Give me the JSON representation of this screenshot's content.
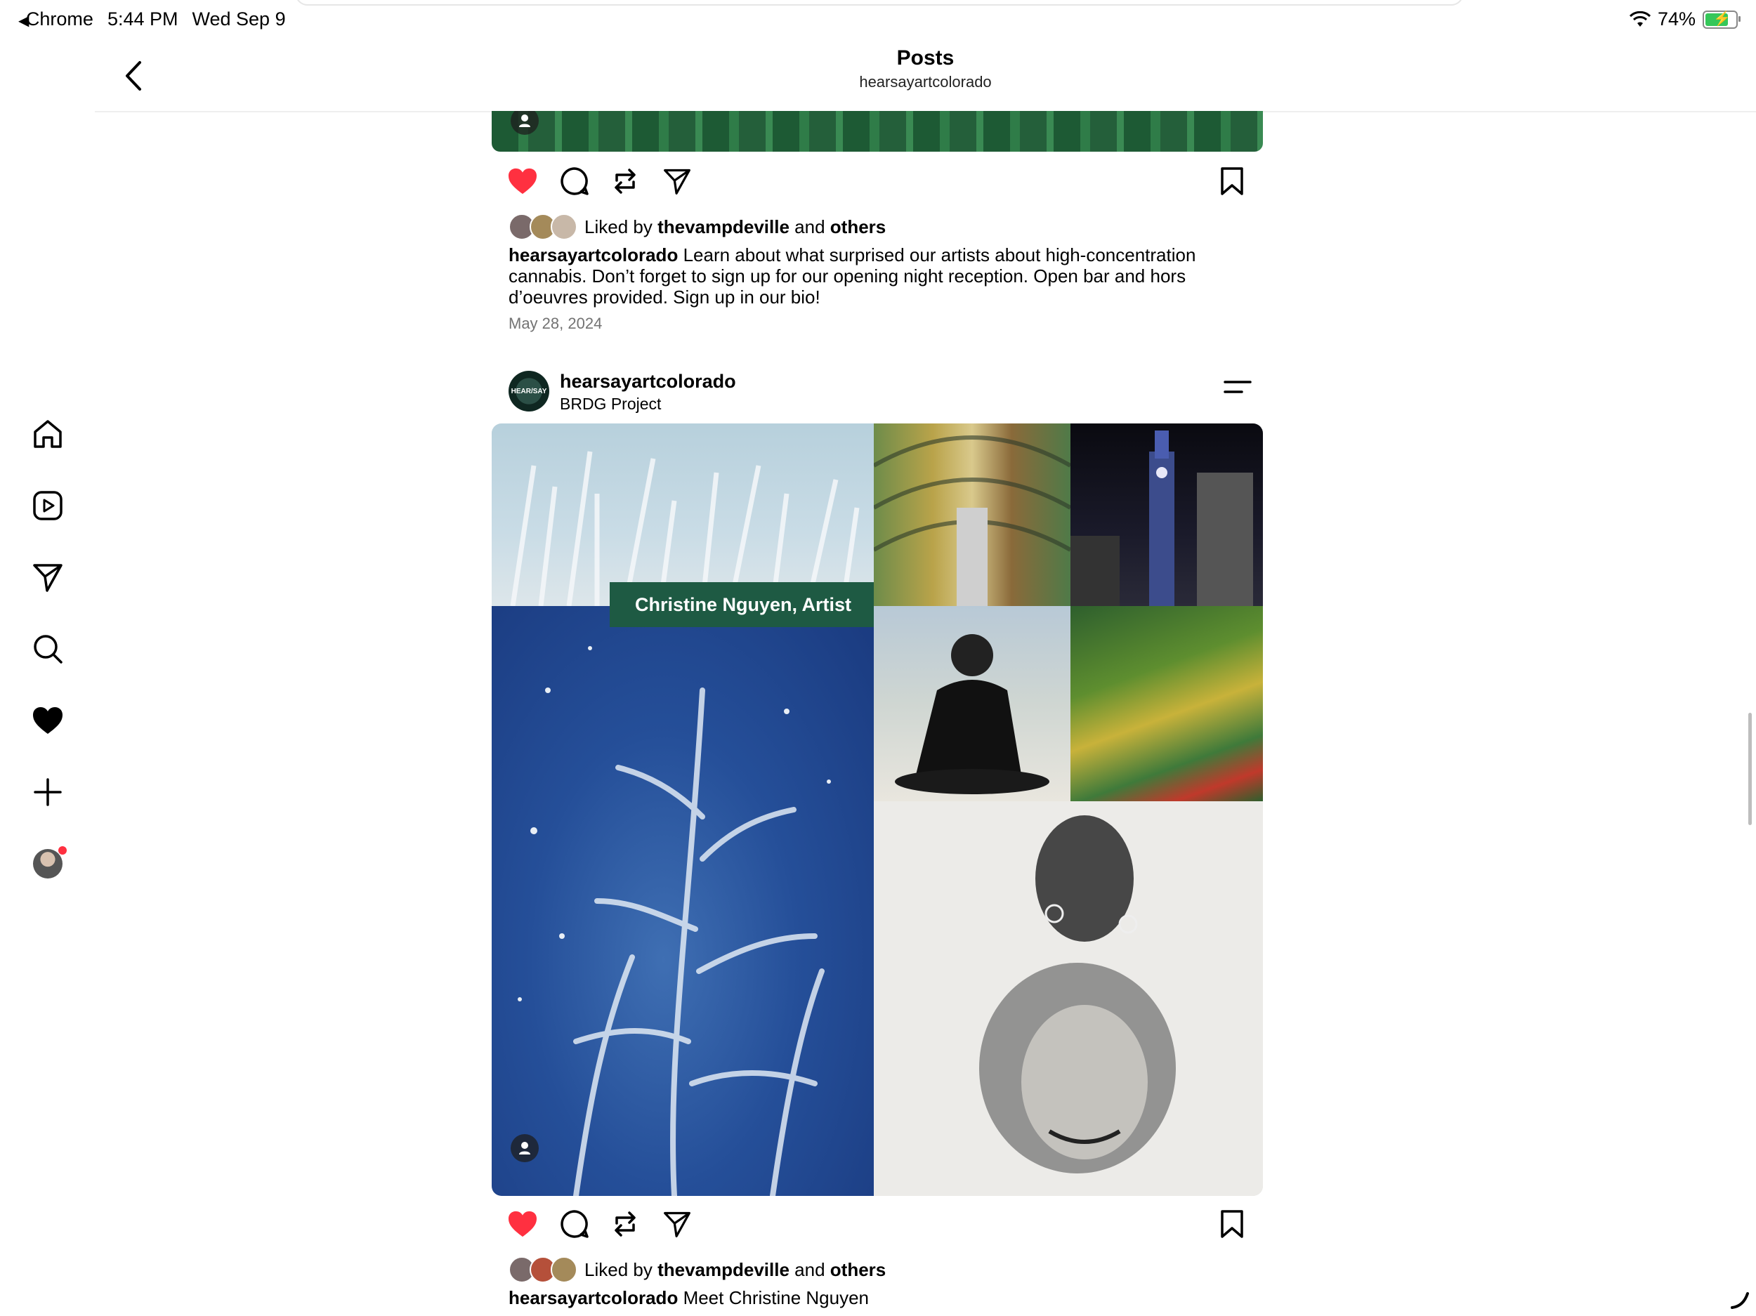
{
  "status_bar": {
    "back_app": "Chrome",
    "time": "5:44 PM",
    "date": "Wed Sep 9",
    "battery": "74%"
  },
  "header": {
    "title": "Posts",
    "subtitle": "hearsayartcolorado"
  },
  "sidebar": {
    "items": [
      "home-icon",
      "reels-icon",
      "direct-icon",
      "search-icon",
      "activity-heart-icon",
      "create-plus-icon",
      "profile-avatar"
    ]
  },
  "post1": {
    "liked_by_prefix": "Liked by",
    "liked_by_user": "thevampdeville",
    "liked_by_and": "and",
    "liked_by_others": "others",
    "caption_user": "hearsayartcolorado",
    "caption_text": "Learn about what surprised our artists about high-concentration cannabis. Don’t forget to sign up for our opening night reception. Open bar and hors d’oeuvres provided. Sign up in our bio!",
    "date": "May 28, 2024",
    "liked": true
  },
  "post2": {
    "username": "hearsayartcolorado",
    "location": "BRDG Project",
    "avatar_text": "HEAR/SAY",
    "image_label": "Christine Nguyen, Artist",
    "liked_by_prefix": "Liked by",
    "liked_by_user": "thevampdeville",
    "liked_by_and": "and",
    "liked_by_others": "others",
    "caption_user": "hearsayartcolorado",
    "caption_text": "Meet Christine Nguyen",
    "liked": true
  },
  "colors": {
    "like_red": "#ff3040",
    "text": "#000000",
    "muted": "#737373"
  }
}
